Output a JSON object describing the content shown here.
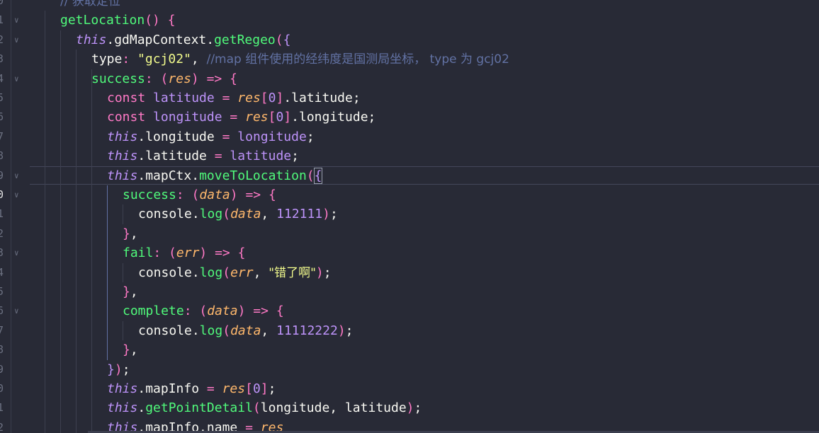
{
  "editor": {
    "line_numbers": [
      "0",
      "1",
      "2",
      "3",
      "4",
      "5",
      "6",
      "7",
      "8",
      "9",
      "0",
      "1",
      "2",
      "3",
      "4",
      "5",
      "6",
      "7",
      "8",
      "9",
      "0",
      "1",
      "2"
    ],
    "active_line_index": 10,
    "code": [
      [
        [
          "cm",
          "// 获取定位"
        ]
      ],
      [
        [
          "fn",
          "getLocation"
        ],
        [
          "br",
          "()"
        ],
        [
          "pl",
          " "
        ],
        [
          "br",
          "{"
        ]
      ],
      [
        [
          "it",
          "this"
        ],
        [
          "pl",
          ".gdMapContext."
        ],
        [
          "fn",
          "getRegeo"
        ],
        [
          "br",
          "("
        ],
        [
          "bv",
          "{"
        ]
      ],
      [
        [
          "pl",
          "type"
        ],
        [
          "pr",
          ":"
        ],
        [
          "pl",
          " "
        ],
        [
          "st",
          "\"gcj02\""
        ],
        [
          "pl",
          ", "
        ],
        [
          "cm",
          "//map 组件使用的经纬度是国测局坐标， type 为 gcj02"
        ]
      ],
      [
        [
          "fn",
          "success"
        ],
        [
          "pr",
          ":"
        ],
        [
          "pl",
          " "
        ],
        [
          "br",
          "("
        ],
        [
          "pm",
          "res"
        ],
        [
          "br",
          ")"
        ],
        [
          "pl",
          " "
        ],
        [
          "kw",
          "=>"
        ],
        [
          "pl",
          " "
        ],
        [
          "br",
          "{"
        ]
      ],
      [
        [
          "kw",
          "const"
        ],
        [
          "pl",
          " "
        ],
        [
          "nm",
          "latitude"
        ],
        [
          "pl",
          " "
        ],
        [
          "kw",
          "="
        ],
        [
          "pl",
          " "
        ],
        [
          "pm",
          "res"
        ],
        [
          "br",
          "["
        ],
        [
          "nm",
          "0"
        ],
        [
          "br",
          "]"
        ],
        [
          "pl",
          ".latitude;"
        ]
      ],
      [
        [
          "kw",
          "const"
        ],
        [
          "pl",
          " "
        ],
        [
          "nm",
          "longitude"
        ],
        [
          "pl",
          " "
        ],
        [
          "kw",
          "="
        ],
        [
          "pl",
          " "
        ],
        [
          "pm",
          "res"
        ],
        [
          "br",
          "["
        ],
        [
          "nm",
          "0"
        ],
        [
          "br",
          "]"
        ],
        [
          "pl",
          ".longitude;"
        ]
      ],
      [
        [
          "it",
          "this"
        ],
        [
          "pl",
          ".longitude "
        ],
        [
          "kw",
          "="
        ],
        [
          "pl",
          " "
        ],
        [
          "nm",
          "longitude"
        ],
        [
          "pl",
          ";"
        ]
      ],
      [
        [
          "it",
          "this"
        ],
        [
          "pl",
          ".latitude "
        ],
        [
          "kw",
          "="
        ],
        [
          "pl",
          " "
        ],
        [
          "nm",
          "latitude"
        ],
        [
          "pl",
          ";"
        ]
      ],
      [
        [
          "it",
          "this"
        ],
        [
          "pl",
          ".mapCtx."
        ],
        [
          "fn",
          "moveToLocation"
        ],
        [
          "br",
          "("
        ],
        [
          "bv",
          "{"
        ]
      ],
      [
        [
          "fn",
          "success"
        ],
        [
          "pr",
          ":"
        ],
        [
          "pl",
          " "
        ],
        [
          "br",
          "("
        ],
        [
          "pm",
          "data"
        ],
        [
          "br",
          ")"
        ],
        [
          "pl",
          " "
        ],
        [
          "kw",
          "=>"
        ],
        [
          "pl",
          " "
        ],
        [
          "br",
          "{"
        ]
      ],
      [
        [
          "pl",
          "console."
        ],
        [
          "fn",
          "log"
        ],
        [
          "br",
          "("
        ],
        [
          "pm",
          "data"
        ],
        [
          "pl",
          ", "
        ],
        [
          "nm",
          "112111"
        ],
        [
          "br",
          ")"
        ],
        [
          "pl",
          ";"
        ]
      ],
      [
        [
          "br",
          "}"
        ],
        [
          "pl",
          ","
        ]
      ],
      [
        [
          "fn",
          "fail"
        ],
        [
          "pr",
          ":"
        ],
        [
          "pl",
          " "
        ],
        [
          "br",
          "("
        ],
        [
          "pm",
          "err"
        ],
        [
          "br",
          ")"
        ],
        [
          "pl",
          " "
        ],
        [
          "kw",
          "=>"
        ],
        [
          "pl",
          " "
        ],
        [
          "br",
          "{"
        ]
      ],
      [
        [
          "pl",
          "console."
        ],
        [
          "fn",
          "log"
        ],
        [
          "br",
          "("
        ],
        [
          "pm",
          "err"
        ],
        [
          "pl",
          ", "
        ],
        [
          "st",
          "\"错了啊\""
        ],
        [
          "br",
          ")"
        ],
        [
          "pl",
          ";"
        ]
      ],
      [
        [
          "br",
          "}"
        ],
        [
          "pl",
          ","
        ]
      ],
      [
        [
          "fn",
          "complete"
        ],
        [
          "pr",
          ":"
        ],
        [
          "pl",
          " "
        ],
        [
          "br",
          "("
        ],
        [
          "pm",
          "data"
        ],
        [
          "br",
          ")"
        ],
        [
          "pl",
          " "
        ],
        [
          "kw",
          "=>"
        ],
        [
          "pl",
          " "
        ],
        [
          "br",
          "{"
        ]
      ],
      [
        [
          "pl",
          "console."
        ],
        [
          "fn",
          "log"
        ],
        [
          "br",
          "("
        ],
        [
          "pm",
          "data"
        ],
        [
          "pl",
          ", "
        ],
        [
          "nm",
          "11112222"
        ],
        [
          "br",
          ")"
        ],
        [
          "pl",
          ";"
        ]
      ],
      [
        [
          "br",
          "}"
        ],
        [
          "pl",
          ","
        ]
      ],
      [
        [
          "bv",
          "}"
        ],
        [
          "br",
          ")"
        ],
        [
          "pl",
          ";"
        ]
      ],
      [
        [
          "it",
          "this"
        ],
        [
          "pl",
          ".mapInfo "
        ],
        [
          "kw",
          "="
        ],
        [
          "pl",
          " "
        ],
        [
          "pm",
          "res"
        ],
        [
          "br",
          "["
        ],
        [
          "nm",
          "0"
        ],
        [
          "br",
          "]"
        ],
        [
          "pl",
          ";"
        ]
      ],
      [
        [
          "it",
          "this"
        ],
        [
          "pl",
          "."
        ],
        [
          "fn",
          "getPointDetail"
        ],
        [
          "br",
          "("
        ],
        [
          "pl",
          "longitude, latitude"
        ],
        [
          "br",
          ")"
        ],
        [
          "pl",
          ";"
        ]
      ],
      [
        [
          "it",
          "this"
        ],
        [
          "pl",
          ".mapInfo.name "
        ],
        [
          "kw",
          "="
        ],
        [
          "pl",
          " "
        ],
        [
          "pm",
          "res"
        ]
      ]
    ],
    "fold_markers": [
      1,
      2,
      4,
      9,
      10,
      13,
      16
    ],
    "colors": {
      "background": "#282a36",
      "comment": "#6272a4",
      "function": "#50fa7b",
      "keyword": "#ff79c6",
      "string": "#f1fa8c",
      "number": "#bd93f9",
      "parameter": "#ffb86c"
    },
    "icons": {
      "fold": "chevron-down-icon"
    }
  }
}
